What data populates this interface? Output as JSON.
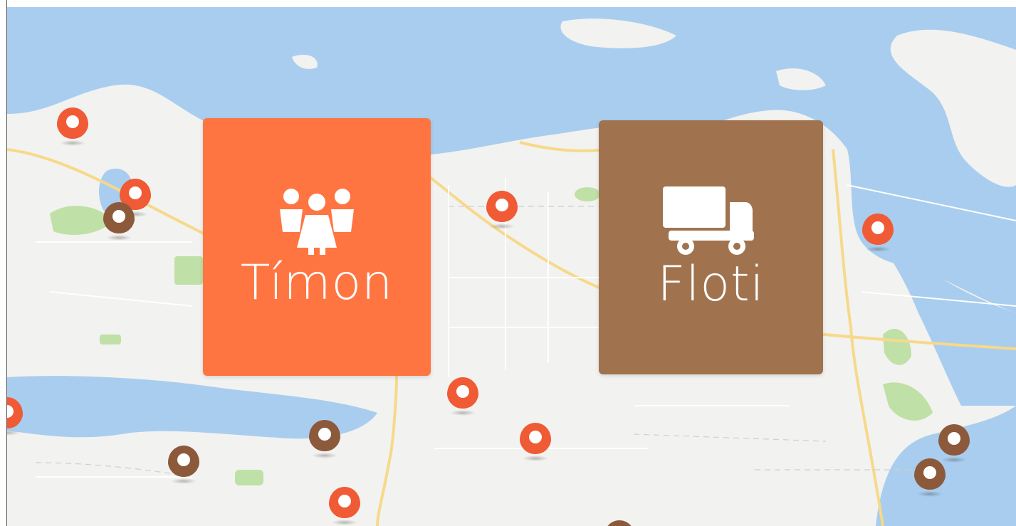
{
  "tiles": [
    {
      "label": "Tímon",
      "icon": "people-group-icon",
      "color": "#ff7542"
    },
    {
      "label": "Floti",
      "icon": "truck-icon",
      "color": "#a0734e"
    }
  ],
  "map": {
    "water_color": "#a9cdee",
    "land_color": "#f2f2f0",
    "park_color": "#bfe0a6",
    "road_color": "#f6d98a",
    "marker_colors": {
      "orange": "#f05a34",
      "brown": "#8c5a3b"
    }
  }
}
